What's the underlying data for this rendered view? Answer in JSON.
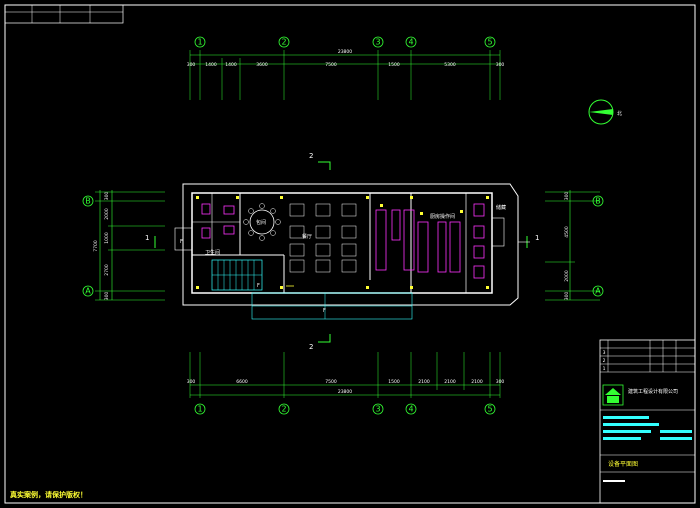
{
  "grid_axes_top": [
    "1",
    "2",
    "3",
    "4",
    "5"
  ],
  "grid_axes_bottom": [
    "1",
    "2",
    "3",
    "4",
    "5"
  ],
  "grid_axes_left": [
    "B",
    "A"
  ],
  "grid_axes_right": [
    "B",
    "A"
  ],
  "top_total_dim": "23800",
  "top_dims": [
    "300",
    "1400",
    "1400",
    "3600",
    "7500",
    "1500",
    "5300",
    "300"
  ],
  "bottom_total_dim": "23800",
  "bottom_dims": [
    "300",
    "6600",
    "7500",
    "1500",
    "2100",
    "2100",
    "2100",
    "300"
  ],
  "left_total_dim": "7700",
  "left_dims": [
    "300",
    "2000",
    "1000",
    "2700",
    "300"
  ],
  "right_dims": [
    "300",
    "4500",
    "2000",
    "300"
  ],
  "section_marks": {
    "top": "2",
    "bottom": "2",
    "left": "1",
    "right": "1"
  },
  "north_label": "北",
  "rooms": {
    "restroom": "卫生间",
    "private_room": "包间",
    "kitchen": "厨房操作间",
    "storage": "储藏",
    "dining": "餐厅"
  },
  "door_marks": [
    "F",
    "F",
    "F"
  ],
  "title_block": {
    "rows": [
      "3",
      "2",
      "1"
    ],
    "company": "建筑工程设计有限公司",
    "drawing_title": "设备平面图"
  },
  "warning": "真实案例，请保护版权！",
  "colors": {
    "background": "#000000",
    "wall": "#ffffff",
    "grid": "#33ff33",
    "furniture": "#ff33ff",
    "fixture": "#ffff33",
    "glass": "#33ffff"
  }
}
